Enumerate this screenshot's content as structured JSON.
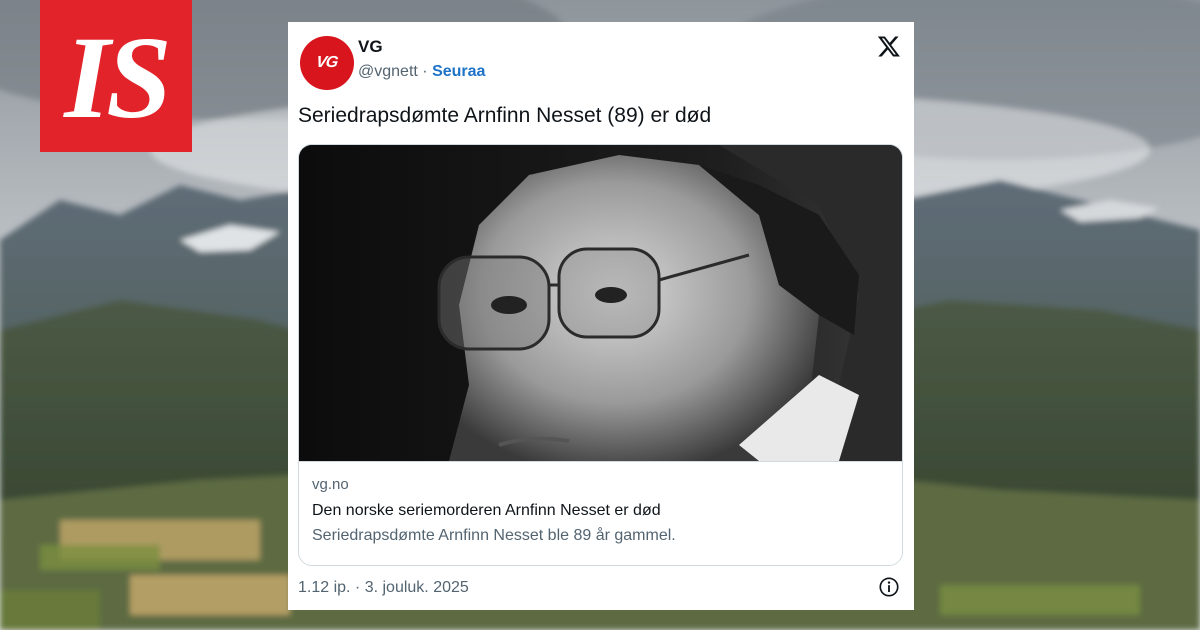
{
  "site_logo": "IS",
  "tweet": {
    "avatar_text": "VG",
    "account_name": "VG",
    "handle": "@vgnett",
    "separator": "·",
    "follow_label": "Seuraa",
    "text": "Seriedrapsdømte Arnfinn Nesset (89) er død",
    "link_card": {
      "domain": "vg.no",
      "title": "Den norske seriemorderen Arnfinn Nesset er død",
      "description": "Seriedrapsdømte Arnfinn Nesset ble 89 år gammel."
    },
    "timestamp": "1.12 ip. · 3. jouluk. 2025",
    "icons": [
      "x-logo-icon",
      "info-icon"
    ]
  },
  "colors": {
    "is_red": "#e2232a",
    "vg_red": "#d8141c",
    "follow_blue": "#1d73c8",
    "muted_text": "#536471"
  }
}
